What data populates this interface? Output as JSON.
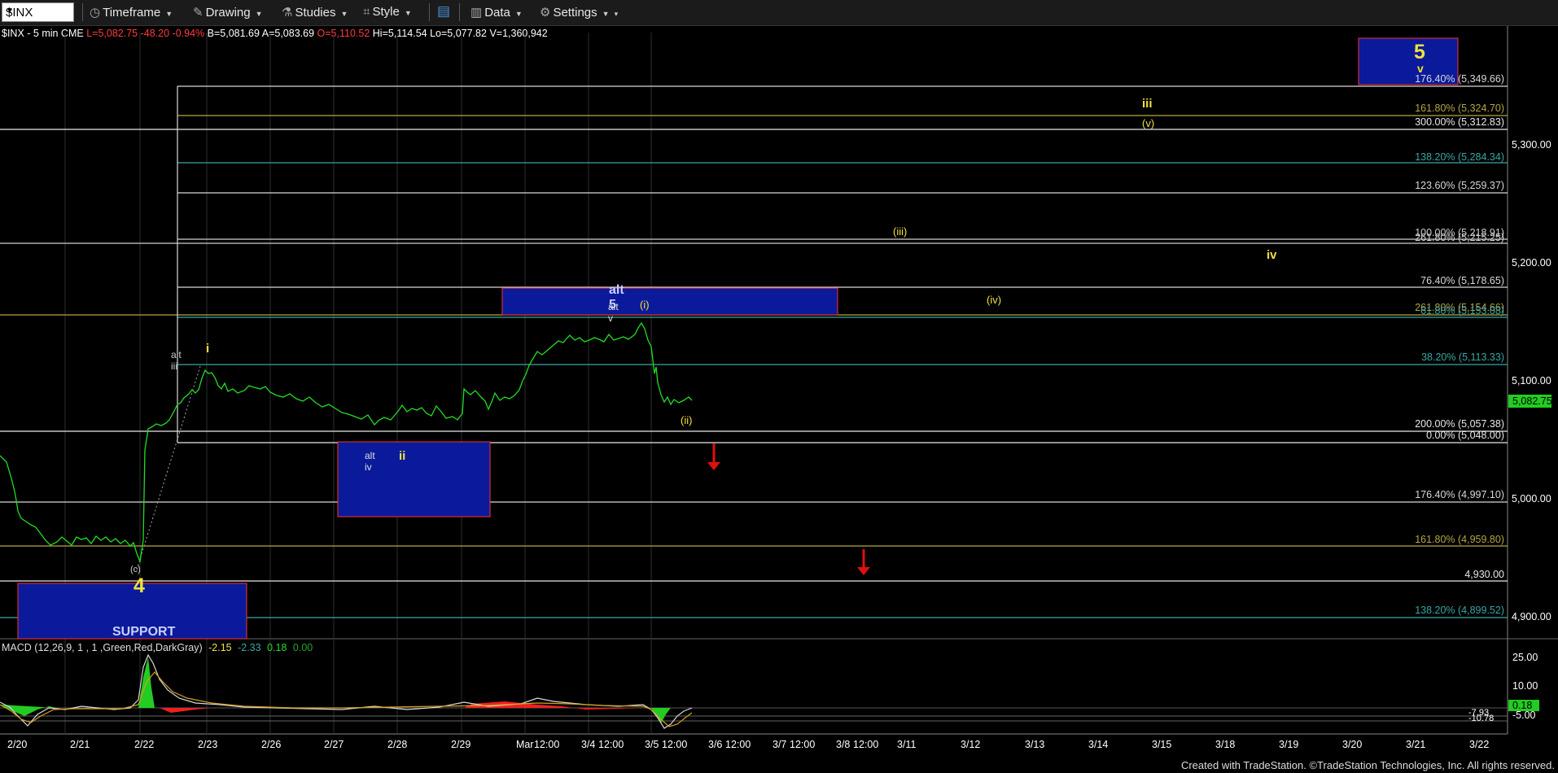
{
  "toolbar": {
    "symbol": "$INX",
    "timeframe": "Timeframe",
    "drawing": "Drawing",
    "studies": "Studies",
    "style": "Style",
    "data": "Data",
    "settings": "Settings"
  },
  "infobar": {
    "symbol": "$INX - 5 min  CME",
    "last": "L=5,082.75",
    "change": "-48.20",
    "change_pct": "-0.94%",
    "bid": "B=5,081.69",
    "ask": "A=5,083.69",
    "open": "O=5,110.52",
    "high": "Hi=5,114.54",
    "low": "Lo=5,077.82",
    "volume": "V=1,360,942"
  },
  "price_axis": {
    "ticks": [
      "5,300.00",
      "5,200.00",
      "5,100.00",
      "5,000.00",
      "4,900.00"
    ],
    "last_price": "5,082.75"
  },
  "fib_levels": [
    {
      "text": "176.40% (5,349.66)",
      "color": "#d8d8d8"
    },
    {
      "text": "161.80% (5,324.70)",
      "color": "#b5a642"
    },
    {
      "text": "300.00% (5,312.83)",
      "color": "#e8e8e8"
    },
    {
      "text": "138.20% (5,284.34)",
      "color": "#3aa6a6"
    },
    {
      "text": "123.60% (5,259.37)",
      "color": "#d8d8d8"
    },
    {
      "text": "100.00% (5,218.91)",
      "color": "#cfcfcf"
    },
    {
      "text": "261.80% (5,215.25)",
      "color": "#cfcfcf"
    },
    {
      "text": "76.40% (5,178.65)",
      "color": "#d8d8d8"
    },
    {
      "text": "261.80% (5,154.66)",
      "color": "#b5a642"
    },
    {
      "text": "61.80% (5,153.08)",
      "color": "#3aa6a6"
    },
    {
      "text": "38.20% (5,113.33)",
      "color": "#3aa6a6"
    },
    {
      "text": "200.00% (5,057.38)",
      "color": "#e8e8e8"
    },
    {
      "text": "0.00% (5,048.00)",
      "color": "#e8e8e8"
    },
    {
      "text": "176.40% (4,997.10)",
      "color": "#d8d8d8"
    },
    {
      "text": "161.80% (4,959.80)",
      "color": "#b5a642"
    },
    {
      "text": "4,930.00",
      "color": "#e8e8e8"
    },
    {
      "text": "138.20% (4,899.52)",
      "color": "#3aa6a6"
    }
  ],
  "wave_labels": {
    "w4": "4",
    "c": "(c)",
    "support": "SUPPORT",
    "alt_iii": "alt iii",
    "i": "i",
    "alt_iv": "alt iv",
    "ii": "ii",
    "alt_5": "alt 5",
    "alt_v": "alt v",
    "wi": "(i)",
    "wii": "(ii)",
    "wiii": "(iii)",
    "wiv": "(iv)",
    "iii": "iii",
    "wv": "(v)",
    "iv": "iv",
    "w5": "5",
    "v": "v"
  },
  "date_axis": [
    "2/20",
    "2/21",
    "2/22",
    "2/23",
    "2/26",
    "2/27",
    "2/28",
    "2/29",
    "Mar",
    "12:00",
    "3/4",
    "12:00",
    "3/5",
    "12:00",
    "3/6",
    "12:00",
    "3/7",
    "12:00",
    "3/8",
    "12:00",
    "3/11",
    "3/12",
    "3/13",
    "3/14",
    "3/15",
    "3/18",
    "3/19",
    "3/20",
    "3/21",
    "3/22"
  ],
  "macd": {
    "label": "MACD (12,26,9, 1 , 1 ,Green,Red,DarkGray)",
    "v1": "-2.15",
    "v2": "-2.33",
    "v3": "0.18",
    "v4": "0.00",
    "ticks": [
      "25.00",
      "10.00",
      "-5.00"
    ],
    "readouts": [
      "0.18",
      "-7.93",
      "-10.78"
    ]
  },
  "footer": "Created with TradeStation. ©TradeStation Technologies, Inc. All rights reserved.",
  "colors": {
    "price": "#22dd22",
    "fib_white": "#d8d8d8",
    "fib_teal": "#3aa6a6",
    "fib_gold": "#b5a642",
    "box_blue": "#0a1a9a",
    "label_yellow": "#f0e040",
    "arrow_red": "#e01010"
  }
}
